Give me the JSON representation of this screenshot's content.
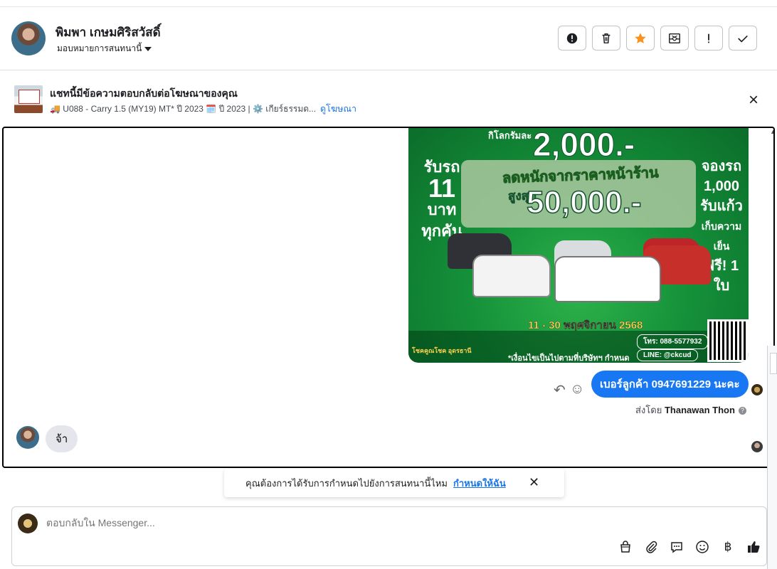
{
  "header": {
    "name": "พิมพา เกษมศิริสวัสดิ์",
    "assign_label": "มอบหมายการสนทนานี้",
    "actions": [
      {
        "icon": "alert-circle-icon"
      },
      {
        "icon": "trash-icon"
      },
      {
        "icon": "star-icon",
        "color": "#f7931e"
      },
      {
        "icon": "mark-unread-icon"
      },
      {
        "icon": "exclamation-icon"
      },
      {
        "icon": "checkmark-icon"
      }
    ]
  },
  "ad": {
    "title": "แชทนี้มีข้อความตอบกลับต่อโฆษณาของคุณ",
    "subtitle": "🚚 U088 - Carry 1.5 (MY19) MT* ปี 2023 🗓️ ปี 2023 | ⚙️ เกียร์ธรรมด...",
    "link": "ดูโฆษณา",
    "close": "×"
  },
  "banner": {
    "small_top": "กิโลกรัมละ",
    "big_price": "2,000.-",
    "left_line1": "รับรถ",
    "left_num": "11",
    "left_line2": "บาท",
    "left_line3": "ทุกคัน",
    "right_line1": "จองรถ",
    "right_line2": "1,000",
    "right_line3": "รับแก้ว",
    "right_line4": "เก็บความเย็น",
    "right_line5": "ฟรี! 1 ใบ",
    "discount": "ลดหนักจากราคาหน้าร้าน",
    "max_label": "สูงสุด",
    "max_value": "50,000.-",
    "date": "11 - 30 พฤศจิกายน 2568",
    "tel": "โทร: 088-5577932",
    "line": "LINE: @ckcud",
    "condition": "*เงื่อนไขเป็นไปตามที่บริษัทฯ กำหนด",
    "logo_text": "โชคคูณโชค อุดรธานี"
  },
  "messages": {
    "outgoing": "เบอร์ลูกค้า 0947691229 นะคะ",
    "sent_by_prefix": "ส่งโดย",
    "sent_by_name": "Thanawan Thon",
    "incoming": "จ้า"
  },
  "toast": {
    "text": "คุณต้องการได้รับการกำหนดไปยังการสนทนานี้ไหม",
    "link": "กำหนดให้ฉัน"
  },
  "composer": {
    "placeholder": "ตอบกลับใน Messenger...",
    "tools": [
      "shopping-bag-icon",
      "paperclip-icon",
      "saved-reply-icon",
      "emoji-icon",
      "baht-icon",
      "thumbs-up-icon"
    ],
    "baht_symbol": "฿"
  }
}
